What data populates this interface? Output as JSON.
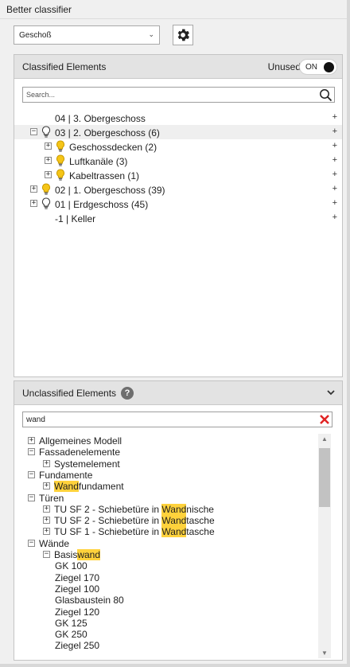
{
  "window": {
    "title": "Better classifier"
  },
  "toolbar": {
    "level_value": "Geschoß",
    "settings_icon": "gear-icon"
  },
  "classified": {
    "title": "Classified Elements",
    "unused_label": "Unused",
    "toggle_label": "ON",
    "toggle_on": true,
    "search_placeholder": "Search...",
    "tree": [
      {
        "label": "04 | 3. Obergeschoss",
        "count": "",
        "level": 0,
        "expander": "none",
        "bulb": "none",
        "selected": false,
        "action": "+"
      },
      {
        "label": "03 | 2. Obergeschoss",
        "count": "(6)",
        "level": 0,
        "expander": "collapse",
        "bulb": "off",
        "selected": true,
        "action": "+"
      },
      {
        "label": "Geschossdecken",
        "count": "(2)",
        "level": 1,
        "expander": "expand",
        "bulb": "on",
        "selected": false,
        "action": "+"
      },
      {
        "label": "Luftkanäle",
        "count": "(3)",
        "level": 1,
        "expander": "expand",
        "bulb": "on",
        "selected": false,
        "action": "+"
      },
      {
        "label": "Kabeltrassen",
        "count": "(1)",
        "level": 1,
        "expander": "expand",
        "bulb": "on",
        "selected": false,
        "action": "+"
      },
      {
        "label": "02 | 1. Obergeschoss",
        "count": "(39)",
        "level": 0,
        "expander": "expand",
        "bulb": "on",
        "selected": false,
        "action": "+"
      },
      {
        "label": "01 | Erdgeschoss",
        "count": "(45)",
        "level": 0,
        "expander": "expand",
        "bulb": "off",
        "selected": false,
        "action": "+"
      },
      {
        "label": "-1 | Keller",
        "count": "",
        "level": 0,
        "expander": "none",
        "bulb": "none",
        "selected": false,
        "action": "+"
      }
    ]
  },
  "unclassified": {
    "title": "Unclassified Elements",
    "help_label": "?",
    "filter_value": "wand",
    "highlight_term": "wand",
    "tree": [
      {
        "label": "Allgemeines Modell",
        "level": 0,
        "expander": "expand"
      },
      {
        "label": "Fassadenelemente",
        "level": 0,
        "expander": "collapse"
      },
      {
        "label": "Systemelement",
        "level": 1,
        "expander": "expand"
      },
      {
        "label": "Fundamente",
        "level": 0,
        "expander": "collapse"
      },
      {
        "label": "Wandfundament",
        "level": 1,
        "expander": "expand"
      },
      {
        "label": "Türen",
        "level": 0,
        "expander": "collapse"
      },
      {
        "label": "TU SF 2 - Schiebetüre in Wandnische",
        "level": 1,
        "expander": "expand"
      },
      {
        "label": "TU SF 2 - Schiebetüre in Wandtasche",
        "level": 1,
        "expander": "expand"
      },
      {
        "label": "TU SF 1 - Schiebetüre in Wandtasche",
        "level": 1,
        "expander": "expand"
      },
      {
        "label": "Wände",
        "level": 0,
        "expander": "collapse"
      },
      {
        "label": "Basiswand",
        "level": 1,
        "expander": "collapse"
      },
      {
        "label": "GK 100",
        "level": 2,
        "expander": "none"
      },
      {
        "label": "Ziegel 170",
        "level": 2,
        "expander": "none"
      },
      {
        "label": "Ziegel 100",
        "level": 2,
        "expander": "none"
      },
      {
        "label": "Glasbaustein 80",
        "level": 2,
        "expander": "none"
      },
      {
        "label": "Ziegel 120",
        "level": 2,
        "expander": "none"
      },
      {
        "label": "GK 125",
        "level": 2,
        "expander": "none"
      },
      {
        "label": "GK 250",
        "level": 2,
        "expander": "none"
      },
      {
        "label": "Ziegel 250",
        "level": 2,
        "expander": "none"
      }
    ]
  },
  "colors": {
    "highlight": "#ffd23c",
    "bulb_on": "#f5c518",
    "clear_icon": "#e02424"
  }
}
